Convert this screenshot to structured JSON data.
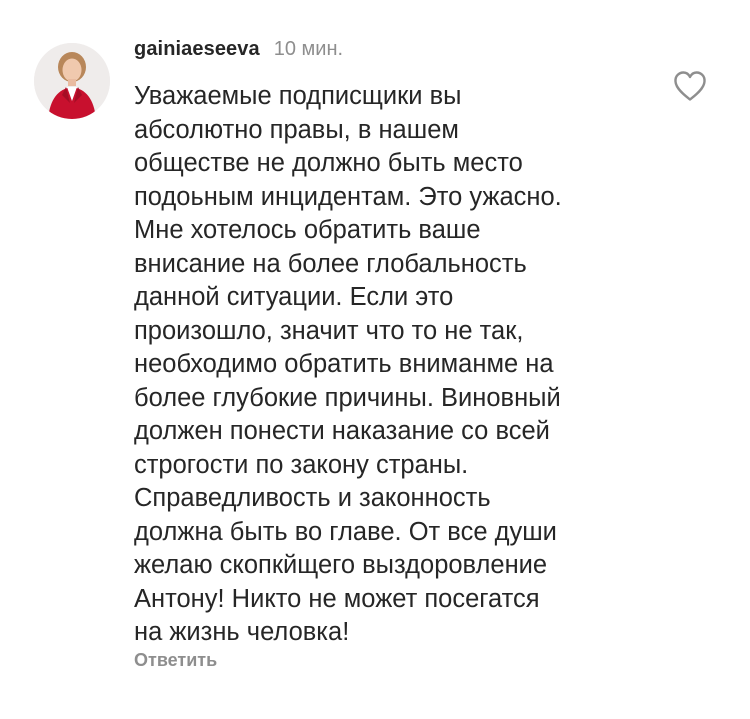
{
  "comment": {
    "username": "gainiaeseeva",
    "timestamp": "10 мин.",
    "avatar_icon": "profile-photo-woman-red-jacket",
    "like_icon": "heart-outline-icon",
    "text_lines": [
      "Уважаемые подписщики вы",
      "абсолютно правы, в нашем",
      "обществе не должно быть место",
      "подоьным инцидентам. Это ужасно.",
      "Мне хотелось обратить ваше",
      "внисание на более глобальность",
      "данной ситуации. Если это",
      "произошло, значит что то не так,",
      "необходимо обратить вниманме на",
      "более глубокие причины. Виновный",
      "должен понести наказание со всей",
      "строгости по закону страны.",
      "Справедливость и законность",
      "должна быть во главе. От все души",
      "желаю скопкйщего выздоровление",
      "Антону! Никто не может посегатся",
      "на жизнь человка!"
    ],
    "reply_label": "Ответить"
  },
  "colors": {
    "text": "#262626",
    "secondary": "#8e8e8e",
    "background": "#ffffff"
  }
}
